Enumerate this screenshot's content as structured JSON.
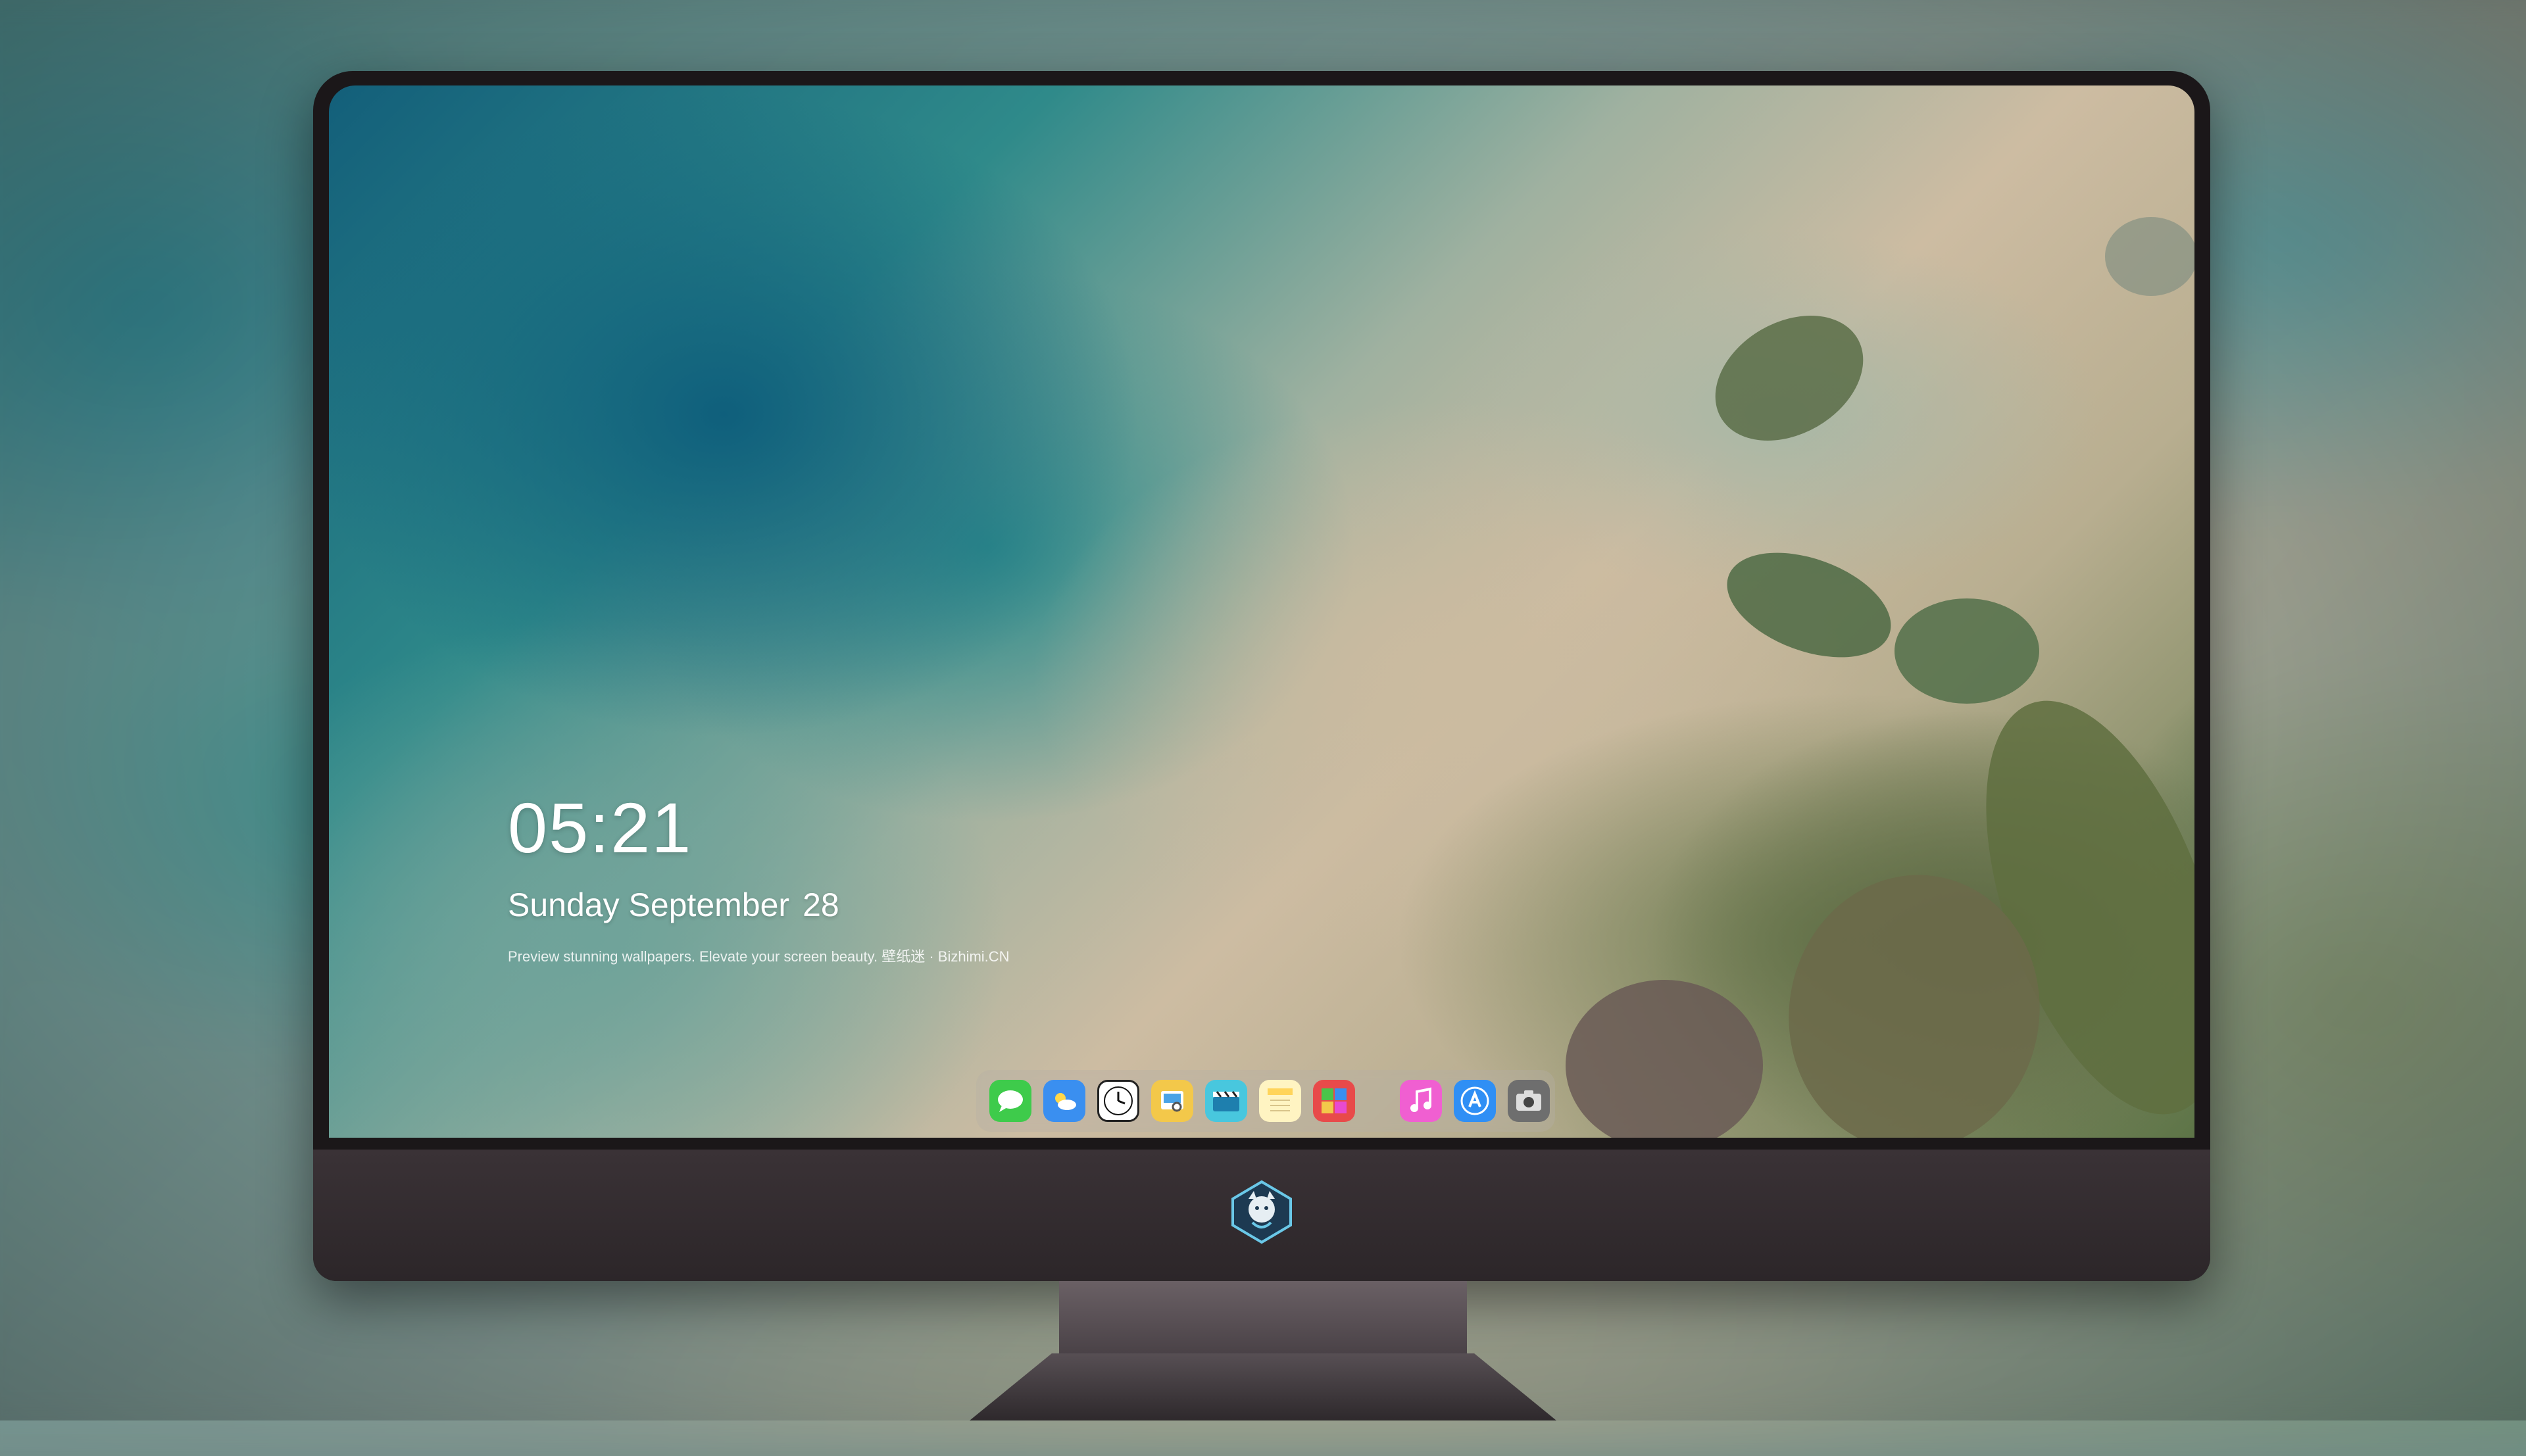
{
  "lockscreen": {
    "time": "05:21",
    "date_weekday_month": "Sunday September",
    "date_day": "28",
    "tagline": "Preview stunning wallpapers. Elevate your screen beauty. 壁纸迷 · Bizhimi.CN"
  },
  "dock": {
    "apps": [
      {
        "name": "messages-icon",
        "color": "#3ecb4b"
      },
      {
        "name": "weather-icon",
        "color": "#3a8ff0"
      },
      {
        "name": "clock-icon",
        "color": "#ffffff"
      },
      {
        "name": "preview-icon",
        "color": "#f3c84a"
      },
      {
        "name": "clips-icon",
        "color": "#48c7de"
      },
      {
        "name": "notes-icon",
        "color": "#ffd45a"
      },
      {
        "name": "photo-booth-icon",
        "color": "#e84a4a"
      },
      {
        "name": "music-icon",
        "color": "#f05fd1"
      },
      {
        "name": "app-store-icon",
        "color": "#2f8ff5"
      },
      {
        "name": "camera-icon",
        "color": "#7a7a7a"
      }
    ]
  }
}
